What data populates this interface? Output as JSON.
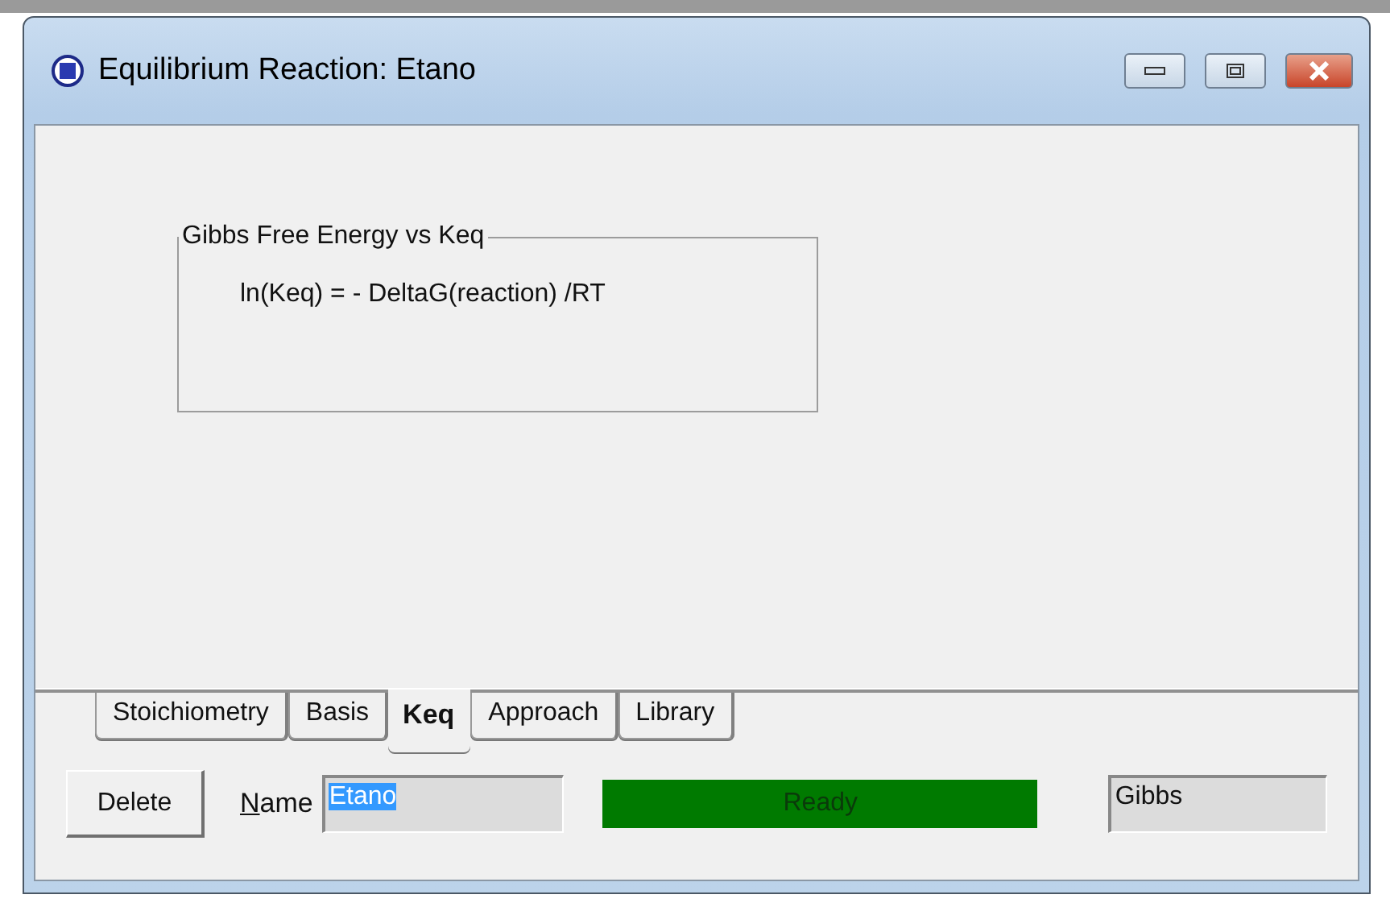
{
  "window": {
    "title": "Equilibrium Reaction: Etano"
  },
  "group": {
    "title": "Gibbs Free Energy vs Keq",
    "formula": "ln(Keq) = - DeltaG(reaction) /RT"
  },
  "tabs": [
    {
      "label": "Stoichiometry",
      "selected": false
    },
    {
      "label": "Basis",
      "selected": false
    },
    {
      "label": "Keq",
      "selected": true
    },
    {
      "label": "Approach",
      "selected": false
    },
    {
      "label": "Library",
      "selected": false
    }
  ],
  "delete_button": "Delete",
  "name_field": {
    "label": "Name",
    "value": "Etano",
    "value_selected": true
  },
  "status": {
    "text": "Ready",
    "color": "#007a00"
  },
  "basis_field": {
    "value": "Gibbs"
  }
}
